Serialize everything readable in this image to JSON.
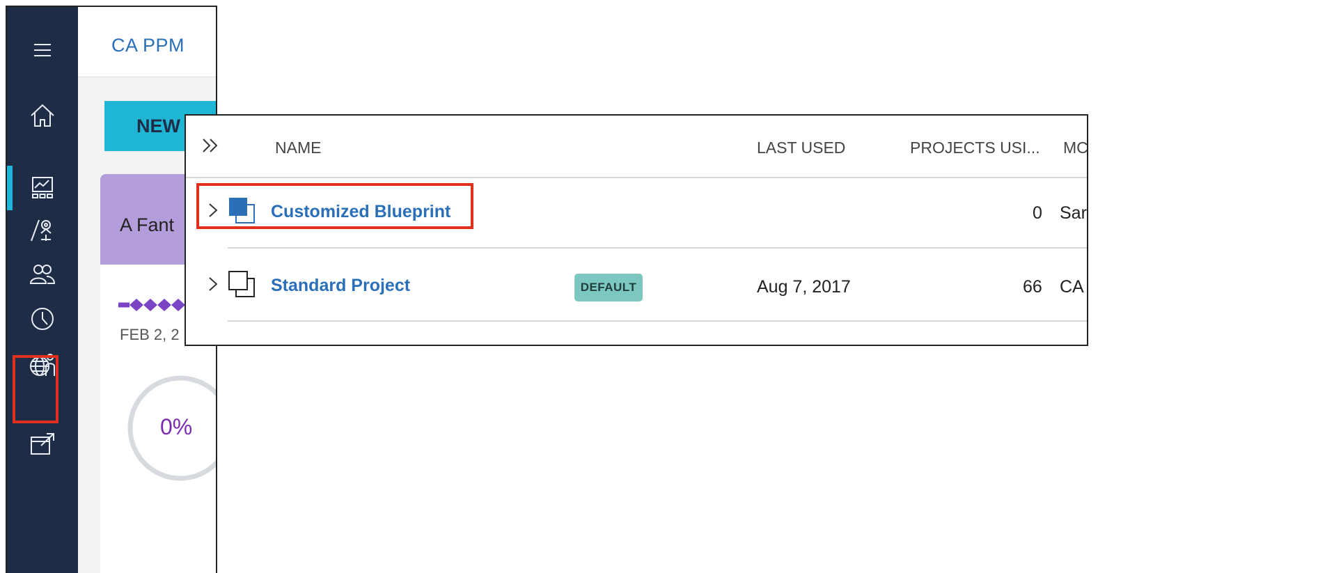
{
  "app": {
    "brand": "CA PPM",
    "new_button_label": "NEW",
    "card": {
      "title": "A Fant",
      "date": "FEB 2, 2",
      "progress_label": "0%",
      "progress": 0
    }
  },
  "sidebar": {
    "items": [
      {
        "icon": "menu-icon"
      },
      {
        "icon": "home-icon"
      },
      {
        "icon": "dashboard-icon",
        "active": true
      },
      {
        "icon": "roadmap-icon"
      },
      {
        "icon": "people-icon"
      },
      {
        "icon": "clock-icon"
      },
      {
        "icon": "global-user-icon",
        "highlighted": true
      },
      {
        "icon": "export-icon"
      }
    ]
  },
  "blueprints": {
    "headers": [
      "NAME",
      "LAST USED",
      "PROJECTS USI...",
      "MC"
    ],
    "rows": [
      {
        "name": "Customized Blueprint",
        "badge": "",
        "last_used": "",
        "projects_using": "0",
        "modified_by": "Sar",
        "icon": "blueprint-copy-icon-filled"
      },
      {
        "name": "Standard Project",
        "badge": "DEFAULT",
        "last_used": "Aug 7, 2017",
        "projects_using": "66",
        "modified_by": "CA",
        "icon": "blueprint-copy-icon-outline"
      }
    ]
  },
  "colors": {
    "sidebar": "#1f2c45",
    "accent": "#1fb6d6",
    "link": "#2a6fb8",
    "highlight": "#e0301e",
    "badge": "#7cc8c0",
    "card_header": "#b39ddb"
  }
}
